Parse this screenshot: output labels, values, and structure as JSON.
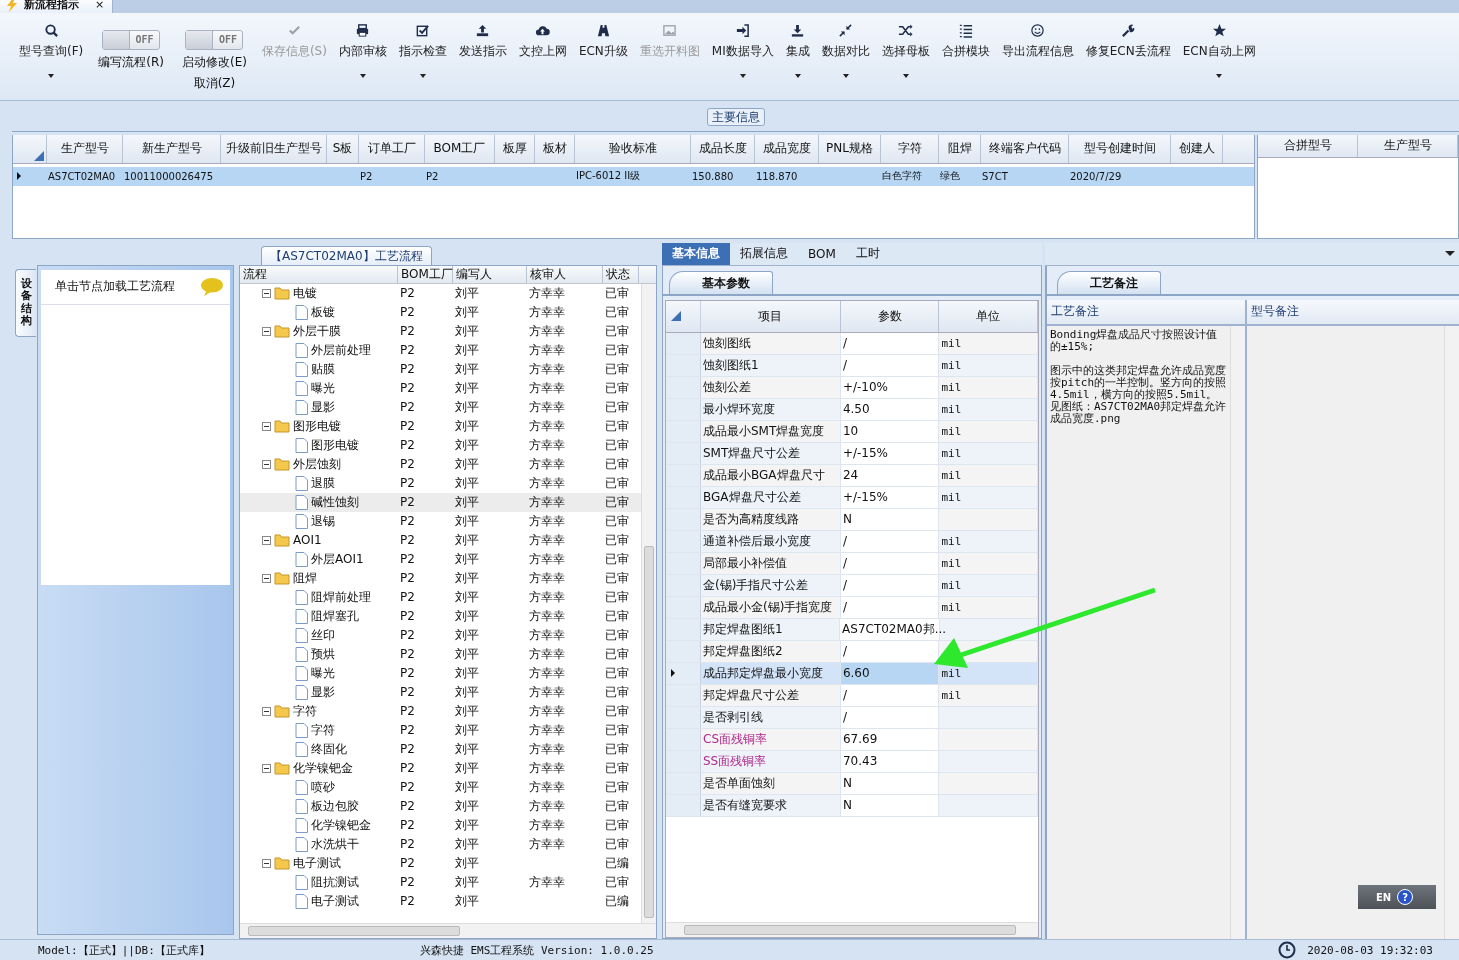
{
  "window": {
    "title": "新流程指示",
    "close": "×"
  },
  "toolbar": [
    {
      "kind": "button",
      "label": "型号查询(F)",
      "menu": true,
      "disabled": false
    },
    {
      "kind": "toggle",
      "label": "编写流程(R)",
      "text": "OFF",
      "on": false
    },
    {
      "kind": "toggle",
      "label": "启动修改(E)",
      "label2": "取消(Z)",
      "text": "OFF",
      "on": false
    },
    {
      "kind": "button",
      "label": "保存信息(S)",
      "menu": false,
      "disabled": true
    },
    {
      "kind": "button",
      "label": "内部审核",
      "menu": true,
      "disabled": false
    },
    {
      "kind": "button",
      "label": "指示检查",
      "menu": true,
      "disabled": false
    },
    {
      "kind": "button",
      "label": "发送指示",
      "menu": false,
      "disabled": false
    },
    {
      "kind": "button",
      "label": "文控上网",
      "menu": false,
      "disabled": false
    },
    {
      "kind": "button",
      "label": "ECN升级",
      "menu": false,
      "disabled": false
    },
    {
      "kind": "button",
      "label": "重选开料图",
      "menu": false,
      "disabled": true
    },
    {
      "kind": "button",
      "label": "MI数据导入",
      "menu": true,
      "disabled": false
    },
    {
      "kind": "button",
      "label": "集成",
      "menu": true,
      "disabled": false
    },
    {
      "kind": "button",
      "label": "数据对比",
      "menu": true,
      "disabled": false
    },
    {
      "kind": "button",
      "label": "选择母板",
      "menu": true,
      "disabled": false
    },
    {
      "kind": "button",
      "label": "合拼模块",
      "menu": false,
      "disabled": false
    },
    {
      "kind": "button",
      "label": "导出流程信息",
      "menu": false,
      "disabled": false
    },
    {
      "kind": "button",
      "label": "修复ECN丢流程",
      "menu": false,
      "disabled": false
    },
    {
      "kind": "button",
      "label": "ECN自动上网",
      "menu": true,
      "disabled": false
    }
  ],
  "main_info": {
    "title": "主要信息",
    "columns": [
      "生产型号",
      "新生产型号",
      "升级前旧生产型号",
      "S板",
      "订单工厂",
      "BOM工厂",
      "板厚",
      "板材",
      "验收标准",
      "成品长度",
      "成品宽度",
      "PNL规格",
      "字符",
      "阻焊",
      "终端客户代码",
      "型号创建时间",
      "创建人"
    ],
    "rows": [
      {
        "selected": true,
        "cells": [
          "AS7CT02MA0",
          "10011000026475",
          null,
          null,
          "P2",
          "P2",
          null,
          null,
          "IPC-6012 II级",
          "150.880",
          "118.870",
          null,
          "白色字符",
          "绿色",
          "S7CT",
          "2020/7/29",
          null
        ]
      }
    ],
    "side_columns": [
      "合拼型号",
      "生产型号"
    ]
  },
  "sidebar": {
    "tab": "设备结构",
    "hint": "单击节点加载工艺流程"
  },
  "process": {
    "title": "【AS7CT02MA0】工艺流程",
    "columns": [
      "流程",
      "BOM工厂",
      "编写人",
      "核审人",
      "状态"
    ],
    "nodes": [
      {
        "name": "电镀",
        "bom": "P2",
        "writer": "刘平",
        "reviewer": "方幸幸",
        "status": "已审",
        "selected": false,
        "expanded": true,
        "children": [
          {
            "name": "板镀",
            "bom": "P2",
            "writer": "刘平",
            "reviewer": "方幸幸",
            "status": "已审",
            "selected": false
          }
        ]
      },
      {
        "name": "外层干膜",
        "bom": "P2",
        "writer": "刘平",
        "reviewer": "方幸幸",
        "status": "已审",
        "selected": false,
        "expanded": true,
        "children": [
          {
            "name": "外层前处理",
            "bom": "P2",
            "writer": "刘平",
            "reviewer": "方幸幸",
            "status": "已审",
            "selected": false
          },
          {
            "name": "贴膜",
            "bom": "P2",
            "writer": "刘平",
            "reviewer": "方幸幸",
            "status": "已审",
            "selected": false
          },
          {
            "name": "曝光",
            "bom": "P2",
            "writer": "刘平",
            "reviewer": "方幸幸",
            "status": "已审",
            "selected": false
          },
          {
            "name": "显影",
            "bom": "P2",
            "writer": "刘平",
            "reviewer": "方幸幸",
            "status": "已审",
            "selected": false
          }
        ]
      },
      {
        "name": "图形电镀",
        "bom": "P2",
        "writer": "刘平",
        "reviewer": "方幸幸",
        "status": "已审",
        "selected": false,
        "expanded": true,
        "children": [
          {
            "name": "图形电镀",
            "bom": "P2",
            "writer": "刘平",
            "reviewer": "方幸幸",
            "status": "已审",
            "selected": false
          }
        ]
      },
      {
        "name": "外层蚀刻",
        "bom": "P2",
        "writer": "刘平",
        "reviewer": "方幸幸",
        "status": "已审",
        "selected": false,
        "expanded": true,
        "children": [
          {
            "name": "退膜",
            "bom": "P2",
            "writer": "刘平",
            "reviewer": "方幸幸",
            "status": "已审",
            "selected": false
          },
          {
            "name": "碱性蚀刻",
            "bom": "P2",
            "writer": "刘平",
            "reviewer": "方幸幸",
            "status": "已审",
            "selected": true
          },
          {
            "name": "退锡",
            "bom": "P2",
            "writer": "刘平",
            "reviewer": "方幸幸",
            "status": "已审",
            "selected": false
          }
        ]
      },
      {
        "name": "AOI1",
        "bom": "P2",
        "writer": "刘平",
        "reviewer": "方幸幸",
        "status": "已审",
        "selected": false,
        "expanded": true,
        "children": [
          {
            "name": "外层AOI1",
            "bom": "P2",
            "writer": "刘平",
            "reviewer": "方幸幸",
            "status": "已审",
            "selected": false
          }
        ]
      },
      {
        "name": "阻焊",
        "bom": "P2",
        "writer": "刘平",
        "reviewer": "方幸幸",
        "status": "已审",
        "selected": false,
        "expanded": true,
        "children": [
          {
            "name": "阻焊前处理",
            "bom": "P2",
            "writer": "刘平",
            "reviewer": "方幸幸",
            "status": "已审",
            "selected": false
          },
          {
            "name": "阻焊塞孔",
            "bom": "P2",
            "writer": "刘平",
            "reviewer": "方幸幸",
            "status": "已审",
            "selected": false
          },
          {
            "name": "丝印",
            "bom": "P2",
            "writer": "刘平",
            "reviewer": "方幸幸",
            "status": "已审",
            "selected": false
          },
          {
            "name": "预烘",
            "bom": "P2",
            "writer": "刘平",
            "reviewer": "方幸幸",
            "status": "已审",
            "selected": false
          },
          {
            "name": "曝光",
            "bom": "P2",
            "writer": "刘平",
            "reviewer": "方幸幸",
            "status": "已审",
            "selected": false
          },
          {
            "name": "显影",
            "bom": "P2",
            "writer": "刘平",
            "reviewer": "方幸幸",
            "status": "已审",
            "selected": false
          }
        ]
      },
      {
        "name": "字符",
        "bom": "P2",
        "writer": "刘平",
        "reviewer": "方幸幸",
        "status": "已审",
        "selected": false,
        "expanded": true,
        "children": [
          {
            "name": "字符",
            "bom": "P2",
            "writer": "刘平",
            "reviewer": "方幸幸",
            "status": "已审",
            "selected": false
          },
          {
            "name": "终固化",
            "bom": "P2",
            "writer": "刘平",
            "reviewer": "方幸幸",
            "status": "已审",
            "selected": false
          }
        ]
      },
      {
        "name": "化学镍钯金",
        "bom": "P2",
        "writer": "刘平",
        "reviewer": "方幸幸",
        "status": "已审",
        "selected": false,
        "expanded": true,
        "children": [
          {
            "name": "喷砂",
            "bom": "P2",
            "writer": "刘平",
            "reviewer": "方幸幸",
            "status": "已审",
            "selected": false
          },
          {
            "name": "板边包胶",
            "bom": "P2",
            "writer": "刘平",
            "reviewer": "方幸幸",
            "status": "已审",
            "selected": false
          },
          {
            "name": "化学镍钯金",
            "bom": "P2",
            "writer": "刘平",
            "reviewer": "方幸幸",
            "status": "已审",
            "selected": false
          },
          {
            "name": "水洗烘干",
            "bom": "P2",
            "writer": "刘平",
            "reviewer": "方幸幸",
            "status": "已审",
            "selected": false
          }
        ]
      },
      {
        "name": "电子测试",
        "bom": "P2",
        "writer": "刘平",
        "status": "已编",
        "selected": false,
        "expanded": true,
        "children": [
          {
            "name": "阻抗测试",
            "bom": "P2",
            "writer": "刘平",
            "reviewer": "方幸幸",
            "status": "已审",
            "selected": false
          },
          {
            "name": "电子测试",
            "bom": "P2",
            "writer": "刘平",
            "status": "已编",
            "selected": false
          }
        ]
      }
    ]
  },
  "details": {
    "tabs": [
      {
        "label": "基本信息",
        "selected": true
      },
      {
        "label": "拓展信息",
        "selected": false
      },
      {
        "label": "BOM",
        "selected": false
      },
      {
        "label": "工时",
        "selected": false
      }
    ],
    "subtab": "基本参数",
    "columns": [
      "项目",
      "参数",
      "单位"
    ],
    "rows": [
      {
        "item": "蚀刻图纸",
        "value": "/",
        "unit": "mil",
        "selected": false,
        "flagged": false
      },
      {
        "item": "蚀刻图纸1",
        "value": "/",
        "unit": "mil",
        "selected": false,
        "flagged": false
      },
      {
        "item": "蚀刻公差",
        "value": "+/-10%",
        "unit": "mil",
        "selected": false,
        "flagged": false
      },
      {
        "item": "最小焊环宽度",
        "value": "4.50",
        "unit": "mil",
        "selected": false,
        "flagged": false
      },
      {
        "item": "成品最小SMT焊盘宽度",
        "value": "10",
        "unit": "mil",
        "selected": false,
        "flagged": false
      },
      {
        "item": "SMT焊盘尺寸公差",
        "value": "+/-15%",
        "unit": "mil",
        "selected": false,
        "flagged": false
      },
      {
        "item": "成品最小BGA焊盘尺寸",
        "value": "24",
        "unit": "mil",
        "selected": false,
        "flagged": false
      },
      {
        "item": "BGA焊盘尺寸公差",
        "value": "+/-15%",
        "unit": "mil",
        "selected": false,
        "flagged": false
      },
      {
        "item": "是否为高精度线路",
        "value": "N",
        "selected": false,
        "flagged": false
      },
      {
        "item": "通道补偿后最小宽度",
        "value": "/",
        "unit": "mil",
        "selected": false,
        "flagged": false
      },
      {
        "item": "局部最小补偿值",
        "value": "/",
        "unit": "mil",
        "selected": false,
        "flagged": false
      },
      {
        "item": "金(锡)手指尺寸公差",
        "value": "/",
        "unit": "mil",
        "selected": false,
        "flagged": false
      },
      {
        "item": "成品最小金(锡)手指宽度",
        "value": "/",
        "unit": "mil",
        "selected": false,
        "flagged": false
      },
      {
        "item": "邦定焊盘图纸1",
        "value": "AS7CT02MA0邦...",
        "selected": false,
        "flagged": false
      },
      {
        "item": "邦定焊盘图纸2",
        "value": "/",
        "selected": false,
        "flagged": false
      },
      {
        "item": "成品邦定焊盘最小宽度",
        "value": "6.60",
        "unit": "mil",
        "selected": true,
        "flagged": false
      },
      {
        "item": "邦定焊盘尺寸公差",
        "value": "/",
        "unit": "mil",
        "selected": false,
        "flagged": false
      },
      {
        "item": "是否剥引线",
        "value": "/",
        "selected": false,
        "flagged": false
      },
      {
        "item": "CS面残铜率",
        "value": "67.69",
        "selected": false,
        "flagged": true
      },
      {
        "item": "SS面残铜率",
        "value": "70.43",
        "selected": false,
        "flagged": true
      },
      {
        "item": "是否单面蚀刻",
        "value": "N",
        "selected": false,
        "flagged": false
      },
      {
        "item": "是否有缝宽要求",
        "value": "N",
        "selected": false,
        "flagged": false
      }
    ]
  },
  "remarks": {
    "subtab": "工艺备注",
    "columns": [
      "工艺备注",
      "型号备注"
    ],
    "paragraphs": [
      "Bonding焊盘成品尺寸按照设计值的±15%;",
      "图示中的这类邦定焊盘允许成品宽度按pitch的一半控制。竖方向的按照4.5mil，横方向的按照5.5mil。见图纸：AS7CT02MA0邦定焊盘允许成品宽度.png"
    ]
  },
  "language_bar": {
    "label": "EN",
    "help": "?"
  },
  "status_bar": {
    "mode": "Model:【正式】||DB:【正式库】",
    "product": "兴森快捷 EMS工程系统 Version: 1.0.0.25",
    "datetime": "2020-08-03 19:32:03"
  }
}
